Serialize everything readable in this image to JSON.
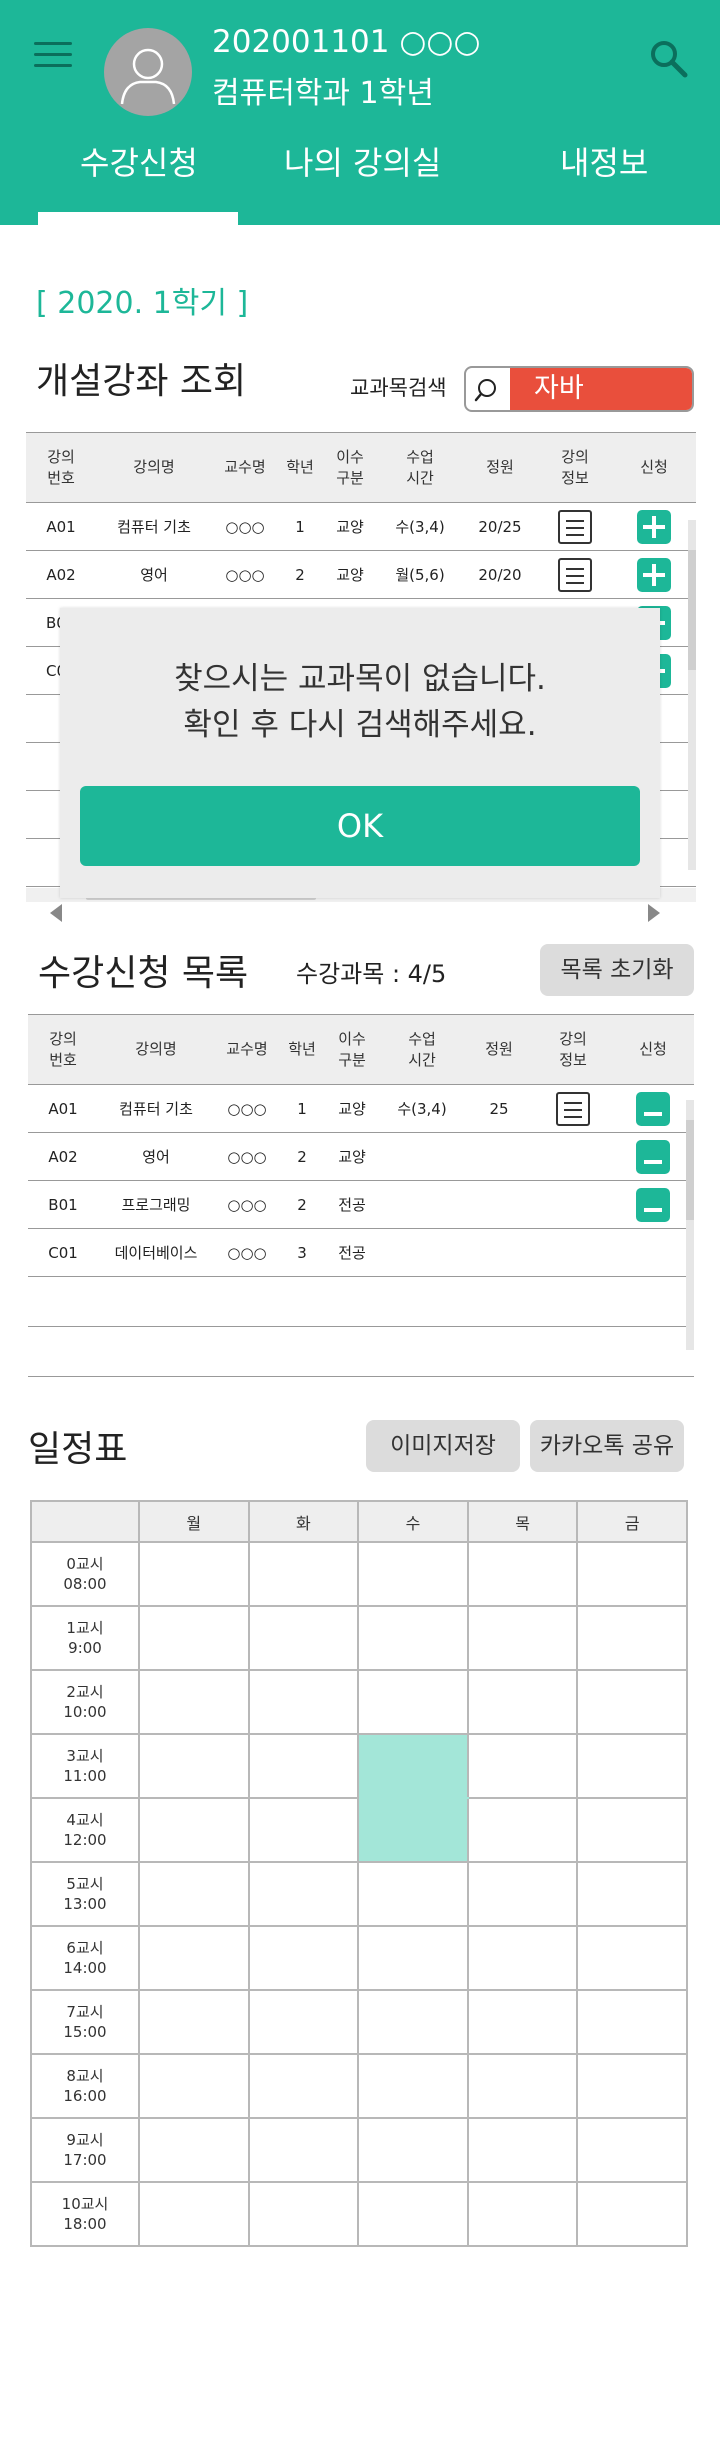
{
  "header": {
    "user_id": "202001101  ○○○",
    "department": "컴퓨터학과 1학년",
    "tabs": [
      "수강신청",
      "나의 강의실",
      "내정보"
    ]
  },
  "semester": "[ 2020. 1학기 ]",
  "course_search": {
    "title": "개설강좌 조회",
    "search_label": "교과목검색",
    "search_value": "자바",
    "columns": [
      "강의\n번호",
      "강의명",
      "교수명",
      "학년",
      "이수\n구분",
      "수업\n시간",
      "정원",
      "강의\n정보",
      "신청"
    ],
    "rows": [
      {
        "no": "A01",
        "name": "컴퓨터 기초",
        "prof": "○○○",
        "year": "1",
        "type": "교양",
        "time": "수(3,4)",
        "cap": "20/25"
      },
      {
        "no": "A02",
        "name": "영어",
        "prof": "○○○",
        "year": "2",
        "type": "교양",
        "time": "월(5,6)",
        "cap": "20/20"
      },
      {
        "no": "B01",
        "name": "",
        "prof": "",
        "year": "",
        "type": "",
        "time": "",
        "cap": ""
      },
      {
        "no": "C01",
        "name": "",
        "prof": "",
        "year": "",
        "type": "",
        "time": "",
        "cap": ""
      }
    ]
  },
  "modal": {
    "line1": "찾으시는 교과목이 없습니다.",
    "line2": "확인 후 다시 검색해주세요.",
    "ok_label": "OK"
  },
  "enrollment": {
    "title": "수강신청 목록",
    "count_label": "수강과목 : 4/5",
    "reset_label": "목록 초기화",
    "columns": [
      "강의\n번호",
      "강의명",
      "교수명",
      "학년",
      "이수\n구분",
      "수업\n시간",
      "정원",
      "강의\n정보",
      "신청"
    ],
    "rows": [
      {
        "no": "A01",
        "name": "컴퓨터 기초",
        "prof": "○○○",
        "year": "1",
        "type": "교양",
        "time": "수(3,4)",
        "cap": "25"
      },
      {
        "no": "A02",
        "name": "영어",
        "prof": "○○○",
        "year": "2",
        "type": "교양",
        "time": "",
        "cap": ""
      },
      {
        "no": "B01",
        "name": "프로그래밍",
        "prof": "○○○",
        "year": "2",
        "type": "전공",
        "time": "",
        "cap": ""
      },
      {
        "no": "C01",
        "name": "데이터베이스",
        "prof": "○○○",
        "year": "3",
        "type": "전공",
        "time": "",
        "cap": ""
      }
    ]
  },
  "schedule": {
    "title": "일정표",
    "save_image_label": "이미지저장",
    "share_label": "카카오톡 공유",
    "days": [
      "월",
      "화",
      "수",
      "목",
      "금"
    ],
    "periods": [
      {
        "label": "0교시",
        "time": "08:00"
      },
      {
        "label": "1교시",
        "time": "9:00"
      },
      {
        "label": "2교시",
        "time": "10:00"
      },
      {
        "label": "3교시",
        "time": "11:00"
      },
      {
        "label": "4교시",
        "time": "12:00"
      },
      {
        "label": "5교시",
        "time": "13:00"
      },
      {
        "label": "6교시",
        "time": "14:00"
      },
      {
        "label": "7교시",
        "time": "15:00"
      },
      {
        "label": "8교시",
        "time": "16:00"
      },
      {
        "label": "9교시",
        "time": "17:00"
      },
      {
        "label": "10교시",
        "time": "18:00"
      }
    ],
    "filled": [
      {
        "day": "수",
        "periods": [
          "3교시",
          "4교시"
        ]
      }
    ]
  },
  "colors": {
    "accent": "#1db798",
    "search_highlight": "#e94f3c",
    "schedule_fill": "#a3e6d8"
  }
}
